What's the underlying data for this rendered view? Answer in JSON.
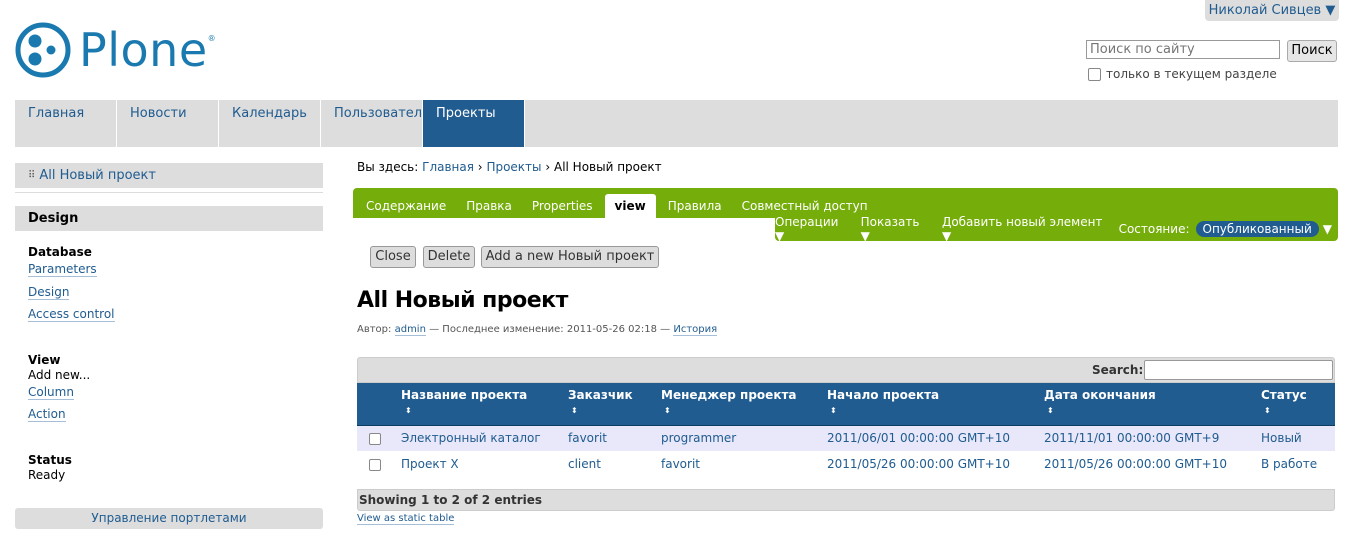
{
  "user": {
    "name": "Николай Сивцев ▼"
  },
  "logo": {
    "text": "Plone",
    "reg": "®"
  },
  "search": {
    "placeholder": "Поиск по сайту",
    "button": "Поиск",
    "scope_label": "только в текущем разделе"
  },
  "nav": {
    "tabs": [
      "Главная",
      "Новости",
      "Календарь",
      "Пользователи",
      "Проекты"
    ],
    "active": "Проекты"
  },
  "sidebar": {
    "nav_item": "All Новый проект",
    "design_header": "Design",
    "database": {
      "heading": "Database",
      "links": [
        "Parameters",
        "Design",
        "Access control"
      ]
    },
    "view": {
      "heading": "View",
      "text": "Add new...",
      "links": [
        "Column",
        "Action"
      ]
    },
    "status": {
      "heading": "Status",
      "value": "Ready"
    },
    "manage_portlets": "Управление портлетами"
  },
  "breadcrumb": {
    "prefix": "Вы здесь:",
    "items": [
      "Главная",
      "Проекты"
    ],
    "current": "All Новый проект",
    "sep": "›"
  },
  "content_tabs": [
    "Содержание",
    "Правка",
    "Properties",
    "view",
    "Правила",
    "Совместный доступ"
  ],
  "content_actions": {
    "operations": "Операции ▼",
    "show": "Показать ▼",
    "add_new": "Добавить новый элемент ▼",
    "state_label": "Состояние:",
    "state_value": "Опубликованный",
    "state_arrow": "▼"
  },
  "buttons": {
    "close": "Close",
    "delete": "Delete",
    "add": "Add a new Новый проект"
  },
  "page": {
    "title": "All Новый проект",
    "byline": {
      "author_label": "Автор:",
      "author": "admin",
      "modified": "— Последнее изменение: 2011-05-26 02:18 —",
      "history": "История"
    }
  },
  "table": {
    "search_label": "Search:",
    "headers": [
      "Название проекта",
      "Заказчик",
      "Менеджер проекта",
      "Начало проекта",
      "Дата окончания",
      "Статус"
    ],
    "sort_glyph": "⬍",
    "rows": [
      [
        "Электронный каталог",
        "favorit",
        "programmer",
        "2011/06/01 00:00:00 GMT+10",
        "2011/11/01 00:00:00 GMT+9",
        "Новый"
      ],
      [
        "Проект X",
        "client",
        "favorit",
        "2011/05/26 00:00:00 GMT+10",
        "2011/05/26 00:00:00 GMT+10",
        "В работе"
      ]
    ],
    "footer": "Showing 1 to 2 of 2 entries",
    "static_link": "View as static table"
  },
  "colors": {
    "brand_blue": "#205c90",
    "green_bar": "#75ad0a",
    "gray_bar": "#dddddd"
  }
}
